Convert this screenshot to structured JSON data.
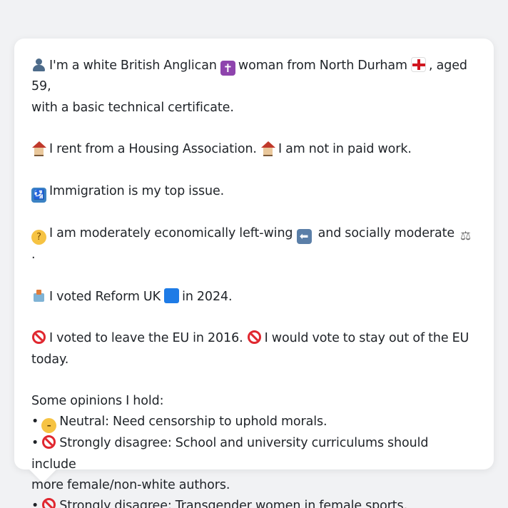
{
  "profile": {
    "identity": {
      "icon": "person-silhouette-icon",
      "text_1": "I'm a white British Anglican",
      "cross_icon": "latin-cross-icon",
      "text_2": "woman from North Durham",
      "flag_icon": "england-flag-icon",
      "text_3": ", aged 59,",
      "text_4": "with a basic technical certificate."
    },
    "housing": {
      "icon": "house-icon",
      "text_1": "I rent from a Housing Association.",
      "icon_2": "house-icon",
      "text_2": "I am not in paid work."
    },
    "issue": {
      "icon": "passport-control-icon",
      "text": "Immigration is my top issue."
    },
    "ideology": {
      "icon": "thinking-face-icon",
      "text_1": "I am moderately economically left-wing",
      "left_icon": "left-arrow-icon",
      "text_2": "and socially moderate",
      "scales_icon": "balance-scale-icon",
      "text_3": "."
    },
    "vote": {
      "icon": "ballot-box-icon",
      "text_1": "I voted Reform UK",
      "party_icon": "blue-square-icon",
      "text_2": "in 2024."
    },
    "eu": {
      "icon": "prohibited-icon",
      "text_1": "I voted to leave the EU in 2016.",
      "icon_2": "prohibited-icon",
      "text_2": "I would vote to stay out of the EU",
      "text_3": "today."
    },
    "opinions": {
      "heading": "Some opinions I hold:",
      "bullet": "•",
      "items": [
        {
          "icon": "neutral-face-icon",
          "text": "Neutral: Need censorship to uphold morals."
        },
        {
          "icon": "prohibited-icon",
          "text": "Strongly disagree: School and university curriculums should include",
          "text_cont": "more female/non-white authors."
        },
        {
          "icon": "prohibited-icon",
          "text": "Strongly disagree: Transgender women in female sports."
        }
      ]
    }
  },
  "colors": {
    "background": "#f1f2f4",
    "bubble": "#ffffff",
    "text": "#1f2328"
  }
}
